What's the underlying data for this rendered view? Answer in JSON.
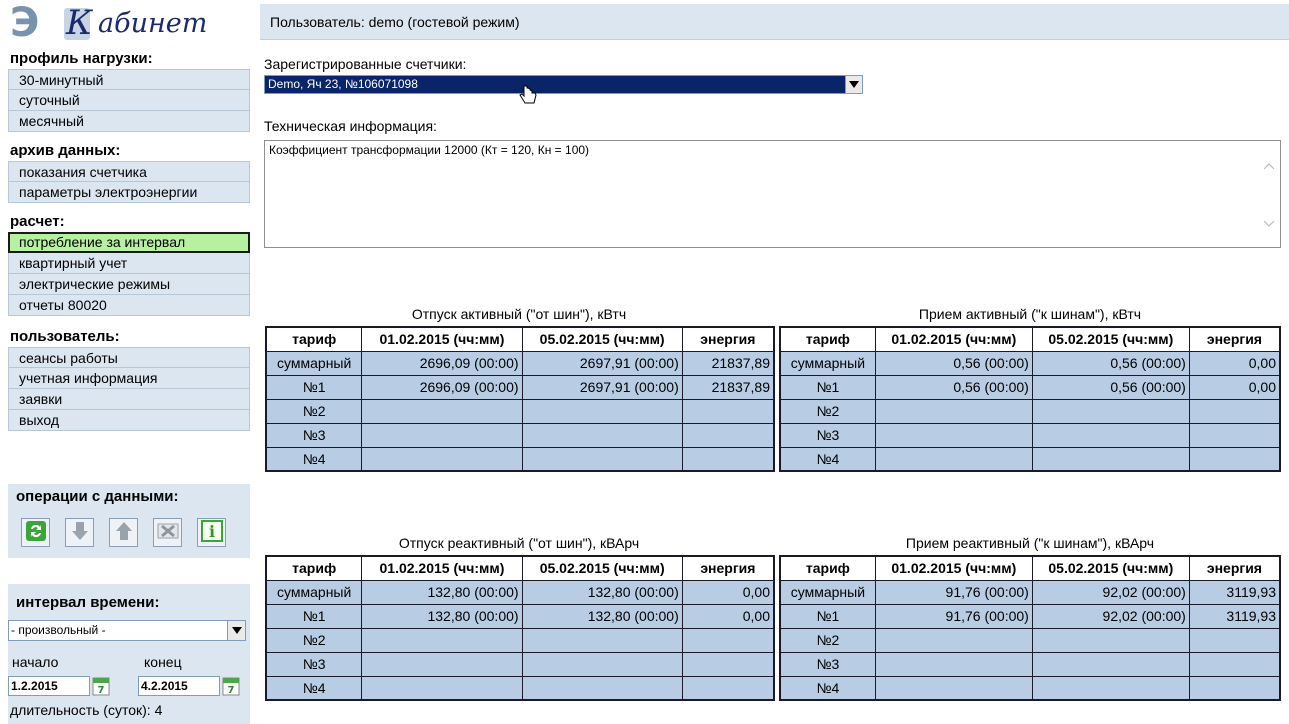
{
  "logo": {
    "e": "Э",
    "k": "К",
    "name": "абинет"
  },
  "menu": {
    "load_profile": {
      "head": "профиль нагрузки:",
      "items": [
        "30-минутный",
        "суточный",
        "месячный"
      ]
    },
    "archive": {
      "head": "архив данных:",
      "items": [
        "показания счетчика",
        "параметры электроэнергии"
      ]
    },
    "calc": {
      "head": "расчет:",
      "items": [
        "потребление за интервал",
        "квартирный учет",
        "электрические режимы",
        "отчеты 80020"
      ],
      "active_index": 0
    },
    "user": {
      "head": "пользователь:",
      "items": [
        "сеансы работы",
        "учетная информация",
        "заявки",
        "выход"
      ]
    }
  },
  "operations": {
    "head": "операции с данными:",
    "buttons": [
      "refresh-icon",
      "download-icon",
      "upload-icon",
      "excel-icon",
      "info-icon"
    ]
  },
  "interval": {
    "head": "интервал времени:",
    "select_value": "- произвольный -",
    "start_label": "начало",
    "end_label": "конец",
    "start_value": "1.2.2015",
    "end_value": "4.2.2015",
    "duration_label": "длительность (суток): 4"
  },
  "header": {
    "user_text": "Пользователь: demo (гостевой режим)"
  },
  "meters": {
    "label": "Зарегистрированные счетчики:",
    "selected": "Demo, Яч 23, №106071098"
  },
  "tech": {
    "label": "Техническая информация:",
    "text": "Коэффициент трансформации 12000 (Кт = 120, Кн = 100)"
  },
  "tables": {
    "headers": [
      "тариф",
      "01.02.2015 (чч:мм)",
      "05.02.2015 (чч:мм)",
      "энергия"
    ],
    "active_out": {
      "title": "Отпуск активный (\"от шин\"), кВтч",
      "rows": [
        [
          "суммарный",
          "2696,09 (00:00)",
          "2697,91 (00:00)",
          "21837,89"
        ],
        [
          "№1",
          "2696,09 (00:00)",
          "2697,91 (00:00)",
          "21837,89"
        ],
        [
          "№2",
          "",
          "",
          ""
        ],
        [
          "№3",
          "",
          "",
          ""
        ],
        [
          "№4",
          "",
          "",
          ""
        ]
      ]
    },
    "active_in": {
      "title": "Прием активный (\"к шинам\"), кВтч",
      "rows": [
        [
          "суммарный",
          "0,56 (00:00)",
          "0,56 (00:00)",
          "0,00"
        ],
        [
          "№1",
          "0,56 (00:00)",
          "0,56 (00:00)",
          "0,00"
        ],
        [
          "№2",
          "",
          "",
          ""
        ],
        [
          "№3",
          "",
          "",
          ""
        ],
        [
          "№4",
          "",
          "",
          ""
        ]
      ]
    },
    "reactive_out": {
      "title": "Отпуск реактивный (\"от шин\"), кВАрч",
      "rows": [
        [
          "суммарный",
          "132,80 (00:00)",
          "132,80 (00:00)",
          "0,00"
        ],
        [
          "№1",
          "132,80 (00:00)",
          "132,80 (00:00)",
          "0,00"
        ],
        [
          "№2",
          "",
          "",
          ""
        ],
        [
          "№3",
          "",
          "",
          ""
        ],
        [
          "№4",
          "",
          "",
          ""
        ]
      ]
    },
    "reactive_in": {
      "title": "Прием реактивный (\"к шинам\"), кВАрч",
      "rows": [
        [
          "суммарный",
          "91,76 (00:00)",
          "92,02 (00:00)",
          "3119,93"
        ],
        [
          "№1",
          "91,76 (00:00)",
          "92,02 (00:00)",
          "3119,93"
        ],
        [
          "№2",
          "",
          "",
          ""
        ],
        [
          "№3",
          "",
          "",
          ""
        ],
        [
          "№4",
          "",
          "",
          ""
        ]
      ]
    }
  },
  "colors": {
    "panel_bg": "#dce6f1",
    "active_item": "#b6f0a0",
    "select_highlight": "#0a246a",
    "table_cell": "#b8cce4"
  }
}
